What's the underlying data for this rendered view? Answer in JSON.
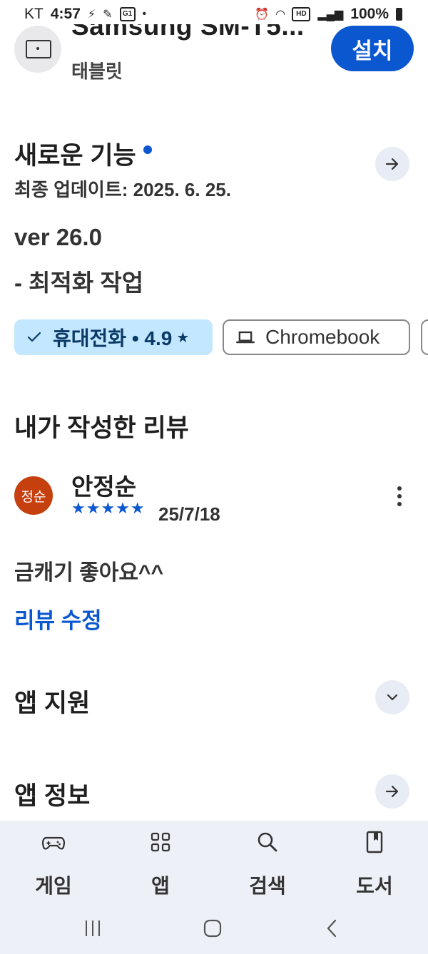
{
  "status_bar": {
    "carrier": "KT",
    "time": "4:57",
    "battery": "100%",
    "hd_badge": "HD",
    "g1_badge": "G1"
  },
  "app": {
    "title": "Samsung SM-T5...",
    "subtitle": "태블릿",
    "install_label": "설치"
  },
  "whats_new": {
    "title": "새로운 기능",
    "updated": "최종 업데이트: 2025. 6. 25.",
    "version": "ver 26.0",
    "note": "- 최적화 작업"
  },
  "device_chips": [
    {
      "label": "휴대전화 • 4.9",
      "selected": true,
      "icon": "check-icon"
    },
    {
      "label": "Chromebook",
      "selected": false,
      "icon": "laptop-icon"
    }
  ],
  "my_review": {
    "title": "내가 작성한 리뷰",
    "avatar_text": "정순",
    "avatar_color": "#c6400f",
    "author": "안정순",
    "stars": "★★★★★",
    "rating": 5,
    "date": "25/7/18",
    "text": "금캐기 좋아요^^",
    "edit_label": "리뷰 수정"
  },
  "app_support": {
    "title": "앱 지원"
  },
  "app_info": {
    "title": "앱 정보"
  },
  "bottom_nav": [
    {
      "label": "게임",
      "icon": "gamepad-icon"
    },
    {
      "label": "앱",
      "icon": "apps-grid-icon"
    },
    {
      "label": "검색",
      "icon": "search-icon"
    },
    {
      "label": "도서",
      "icon": "book-icon"
    }
  ],
  "colors": {
    "accent": "#0b57d0",
    "chip_selected": "#c2e7ff",
    "nav_bg": "#eef0f7"
  }
}
